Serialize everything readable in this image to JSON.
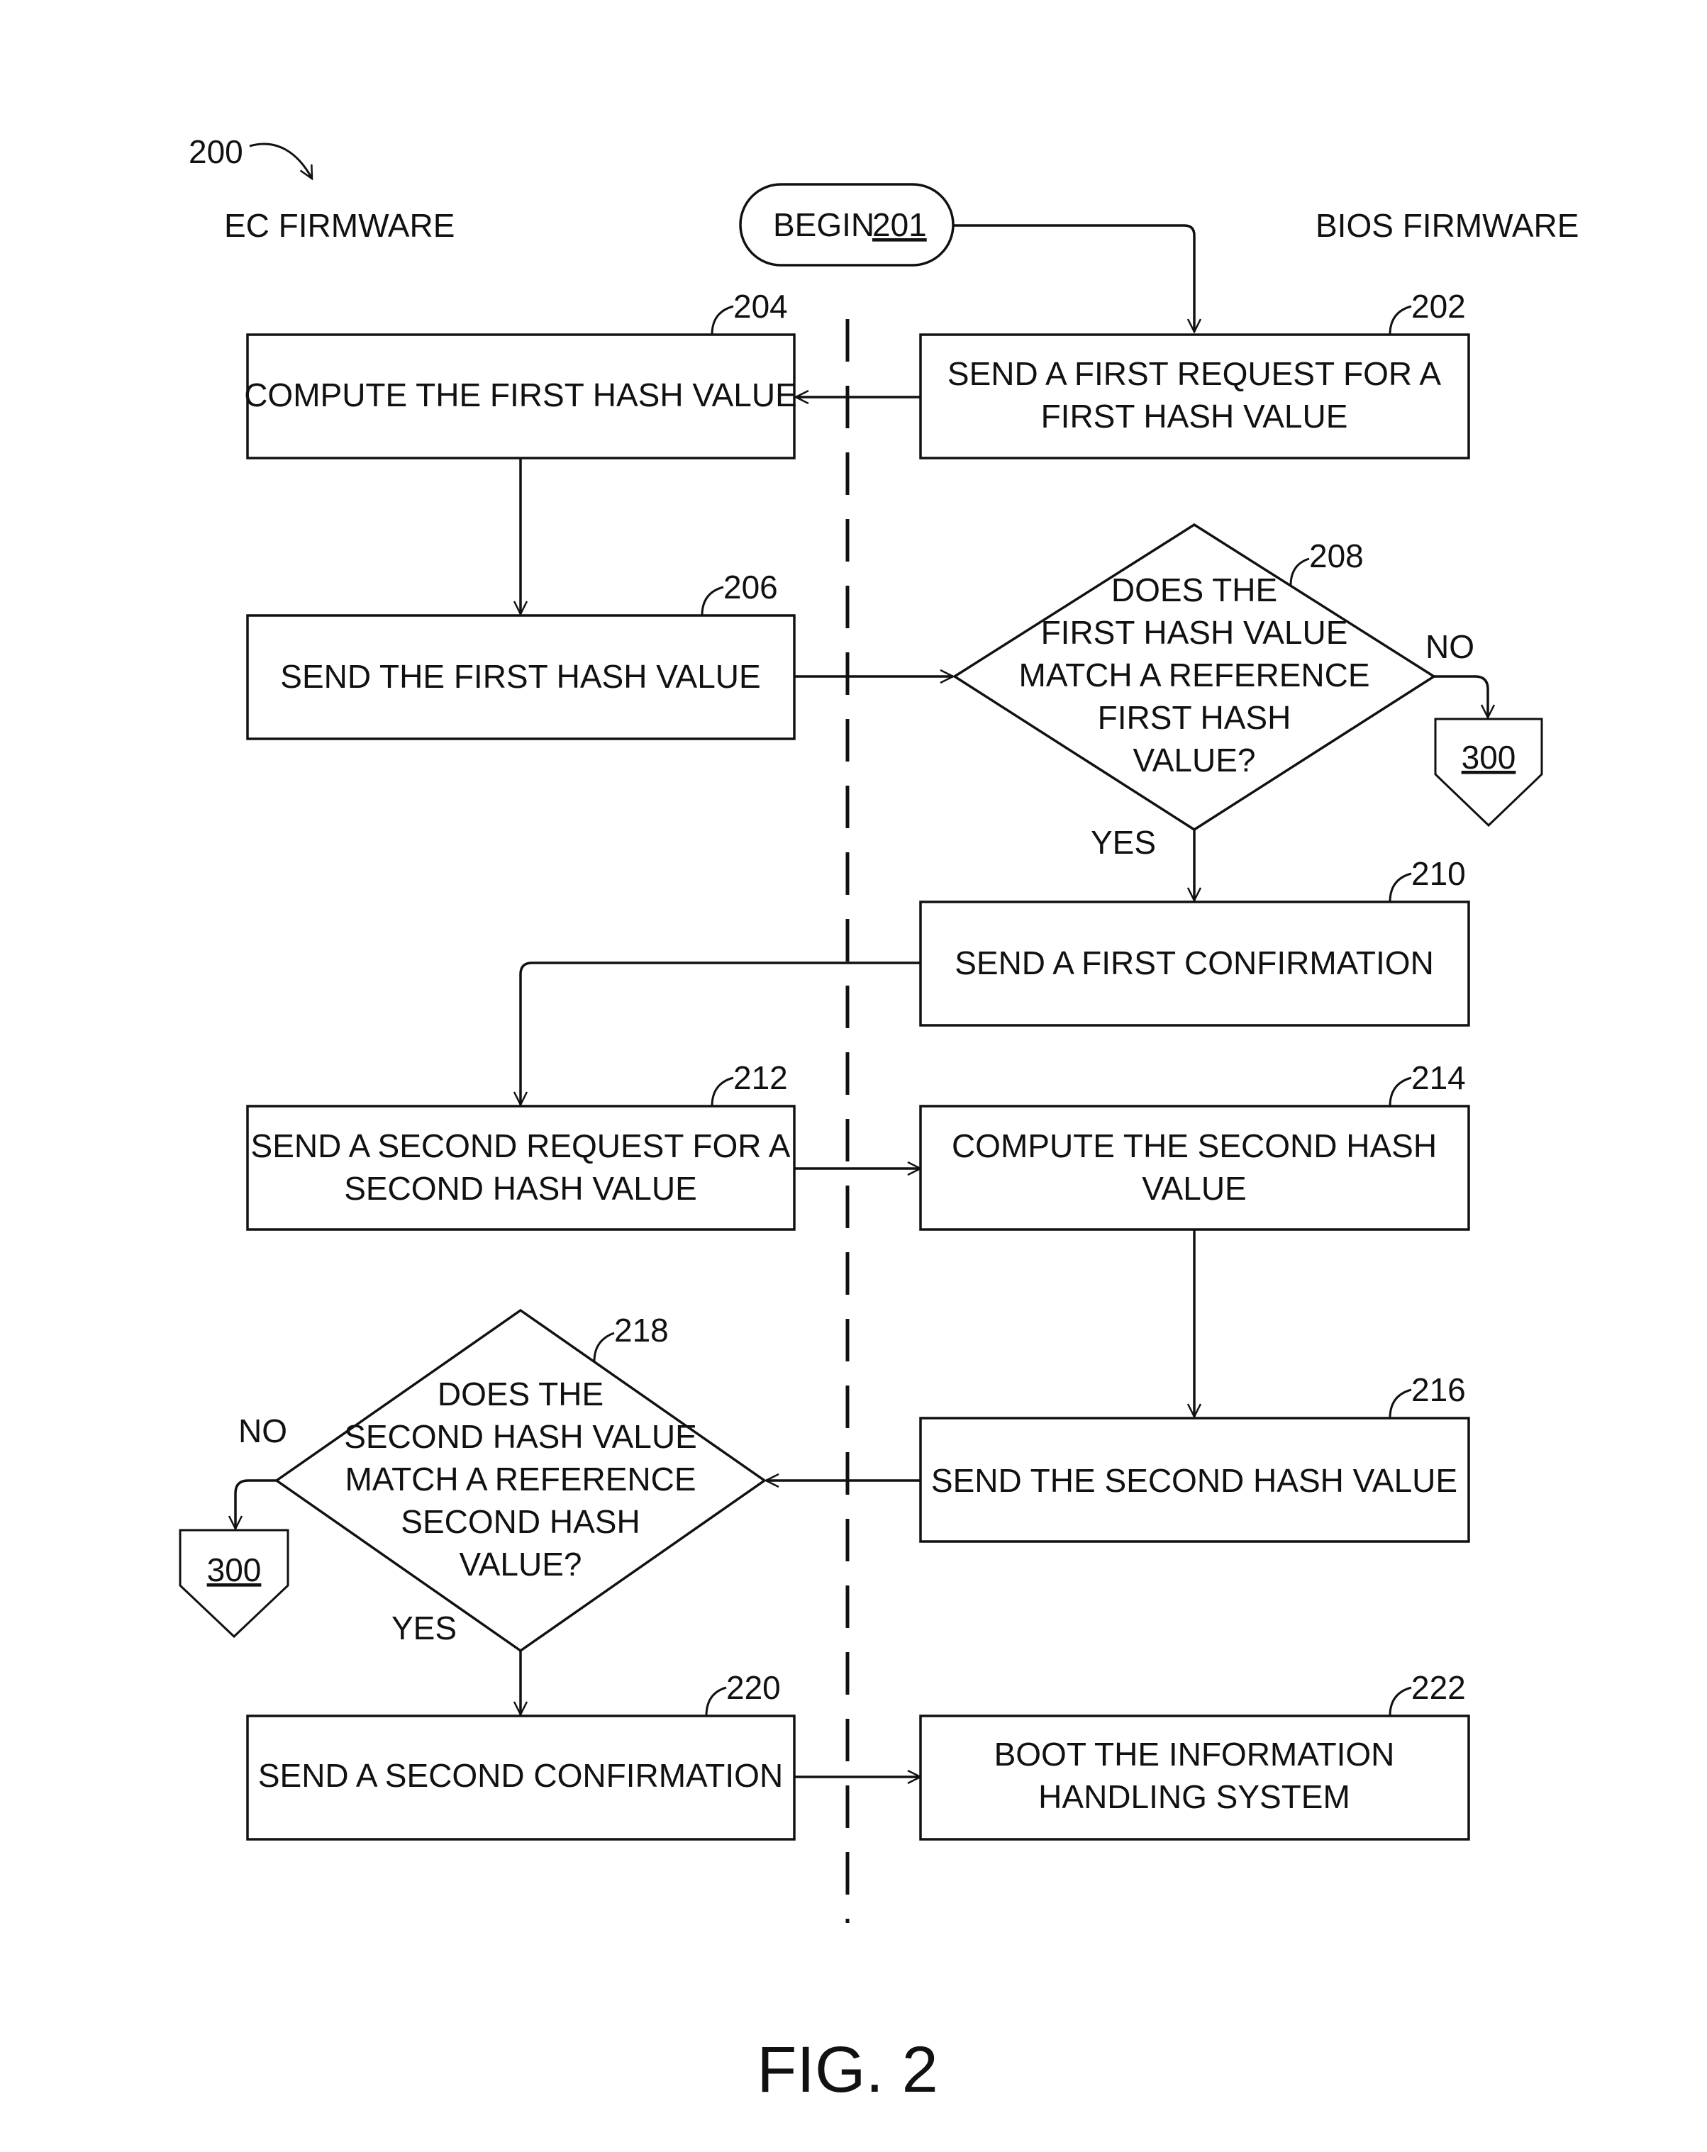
{
  "figure": {
    "number_label": "200",
    "caption": "FIG. 2"
  },
  "lanes": {
    "left": "EC FIRMWARE",
    "right": "BIOS FIRMWARE"
  },
  "begin": {
    "label": "BEGIN",
    "ref": "201"
  },
  "steps": {
    "s202": {
      "ref": "202",
      "lines": [
        "SEND A FIRST REQUEST FOR A",
        "FIRST HASH VALUE"
      ]
    },
    "s204": {
      "ref": "204",
      "lines": [
        "COMPUTE THE FIRST HASH VALUE"
      ]
    },
    "s206": {
      "ref": "206",
      "lines": [
        "SEND THE FIRST HASH VALUE"
      ]
    },
    "s208": {
      "ref": "208",
      "lines": [
        "DOES THE",
        "FIRST HASH VALUE",
        "MATCH A REFERENCE",
        "FIRST HASH",
        "VALUE?"
      ]
    },
    "s210": {
      "ref": "210",
      "lines": [
        "SEND A FIRST CONFIRMATION"
      ]
    },
    "s212": {
      "ref": "212",
      "lines": [
        "SEND A SECOND REQUEST FOR A",
        "SECOND HASH VALUE"
      ]
    },
    "s214": {
      "ref": "214",
      "lines": [
        "COMPUTE THE SECOND HASH",
        "VALUE"
      ]
    },
    "s216": {
      "ref": "216",
      "lines": [
        "SEND THE SECOND HASH VALUE"
      ]
    },
    "s218": {
      "ref": "218",
      "lines": [
        "DOES THE",
        "SECOND HASH VALUE",
        "MATCH A REFERENCE",
        "SECOND HASH",
        "VALUE?"
      ]
    },
    "s220": {
      "ref": "220",
      "lines": [
        "SEND A SECOND CONFIRMATION"
      ]
    },
    "s222": {
      "ref": "222",
      "lines": [
        "BOOT THE INFORMATION",
        "HANDLING SYSTEM"
      ]
    }
  },
  "branches": {
    "yes": "YES",
    "no": "NO"
  },
  "connectors": {
    "offpage_ref": "300"
  }
}
